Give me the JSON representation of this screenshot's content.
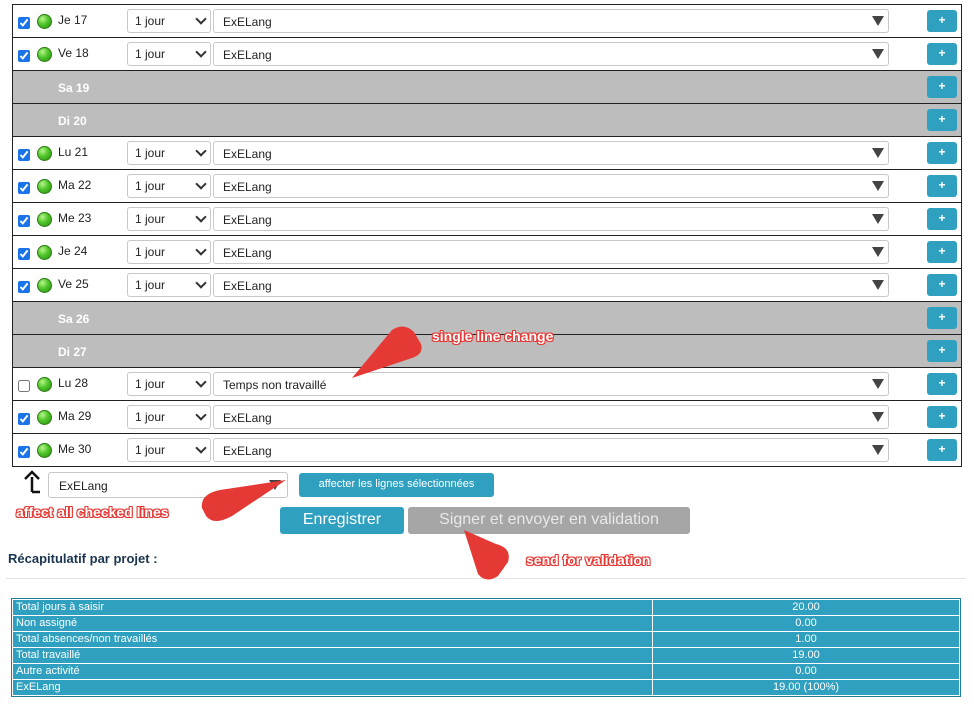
{
  "timesheet": {
    "rows": [
      {
        "day": "Je 17",
        "checked": true,
        "weekend": false,
        "duration": "1 jour",
        "project": "ExELang"
      },
      {
        "day": "Ve 18",
        "checked": true,
        "weekend": false,
        "duration": "1 jour",
        "project": "ExELang"
      },
      {
        "day": "Sa 19",
        "weekend": true
      },
      {
        "day": "Di 20",
        "weekend": true
      },
      {
        "day": "Lu 21",
        "checked": true,
        "weekend": false,
        "duration": "1 jour",
        "project": "ExELang"
      },
      {
        "day": "Ma 22",
        "checked": true,
        "weekend": false,
        "duration": "1 jour",
        "project": "ExELang"
      },
      {
        "day": "Me 23",
        "checked": true,
        "weekend": false,
        "duration": "1 jour",
        "project": "ExELang"
      },
      {
        "day": "Je 24",
        "checked": true,
        "weekend": false,
        "duration": "1 jour",
        "project": "ExELang"
      },
      {
        "day": "Ve 25",
        "checked": true,
        "weekend": false,
        "duration": "1 jour",
        "project": "ExELang"
      },
      {
        "day": "Sa 26",
        "weekend": true
      },
      {
        "day": "Di 27",
        "weekend": true
      },
      {
        "day": "Lu 28",
        "checked": false,
        "weekend": false,
        "duration": "1 jour",
        "project": "Temps non travaillé"
      },
      {
        "day": "Ma 29",
        "checked": true,
        "weekend": false,
        "duration": "1 jour",
        "project": "ExELang"
      },
      {
        "day": "Me 30",
        "checked": true,
        "weekend": false,
        "duration": "1 jour",
        "project": "ExELang"
      }
    ],
    "add_label": "+"
  },
  "bulk": {
    "selected_project": "ExELang",
    "affect_label": "affecter les lignes sélectionnées"
  },
  "actions": {
    "save_label": "Enregistrer",
    "sign_label": "Signer et envoyer en validation"
  },
  "recap": {
    "title": "Récapitulatif par projet :",
    "rows": [
      {
        "label": "Total jours à saisir",
        "value": "20.00"
      },
      {
        "label": "Non assigné",
        "value": "0.00"
      },
      {
        "label": "Total absences/non travaillés",
        "value": "1.00"
      },
      {
        "label": "Total travaillé",
        "value": "19.00"
      },
      {
        "label": "Autre activité",
        "value": "0.00"
      },
      {
        "label": "ExELang",
        "value": "19.00 (100%)"
      }
    ]
  },
  "annotations": {
    "single_line": "single line change",
    "affect_all": "affect all checked lines",
    "send": "send for validation"
  },
  "colors": {
    "accent": "#2fa0bf",
    "weekend": "#bdbdbd",
    "disabled": "#a6a6a6",
    "callout": "#e53935"
  }
}
